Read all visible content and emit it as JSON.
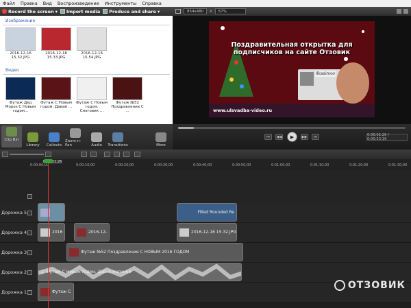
{
  "menu": [
    "Файл",
    "Правка",
    "Вид",
    "Воспроизведение",
    "Инструменты",
    "Справка"
  ],
  "toolbar": {
    "record": "Record the screen",
    "import": "Import media",
    "produce": "Produce and share"
  },
  "preview_toolbar": {
    "size": "854x480",
    "zoom": "67%"
  },
  "clipbin": {
    "images_header": "Изображение",
    "images": [
      {
        "name": "2016-12-16 15.32.JPG",
        "color": "#c9d3e0"
      },
      {
        "name": "2016-12-16 15.33.JPG",
        "color": "#b8282e"
      },
      {
        "name": "2016-12-16 15.54.JPG",
        "color": "#e0e0e0"
      }
    ],
    "video_header": "Видео",
    "videos": [
      {
        "name": "Футаж Дед Мороз С Новым годом…",
        "color": "#0b2a55"
      },
      {
        "name": "Футаж С Новым годом. Давай …",
        "color": "#5a1418"
      },
      {
        "name": "Футаж С Новым годом. Снеговик …",
        "color": "#f0f0f0"
      },
      {
        "name": "Футаж №52 Поздравление С …",
        "color": "#4a1212"
      }
    ]
  },
  "tabs": [
    {
      "label": "Clip Bin",
      "icon": "clip-bin-icon",
      "active": true
    },
    {
      "label": "Library",
      "icon": "library-icon"
    },
    {
      "label": "Callouts",
      "icon": "callouts-icon"
    },
    {
      "label": "Zoom-n-Pan",
      "icon": "zoom-icon"
    },
    {
      "label": "Audio",
      "icon": "audio-icon"
    },
    {
      "label": "Transitions",
      "icon": "transitions-icon"
    },
    {
      "label": "More",
      "icon": "more-icon"
    }
  ],
  "video": {
    "title": "Поздравительная открытка для подписчиков на сайте Отзовик",
    "url": "www.ulsvadba-video.ru",
    "name": "Ilkasimov"
  },
  "transport": {
    "time": "0:00:02;26 / 0:00:53;19",
    "progress": 0.07
  },
  "ruler": [
    "0:00:00;00",
    "0:00:02;26",
    "0:00:10;00",
    "0:00:20;00",
    "0:00:30;00",
    "0:00:40;00",
    "0:00:50;00",
    "0:01:00;00",
    "0:01:10;00",
    "0:01:20;00",
    "0:01:30;00"
  ],
  "tracks": [
    {
      "label": "Дорожка 5",
      "clips": [
        {
          "text": ""
        },
        {
          "text": "Filled Rounded Re"
        }
      ]
    },
    {
      "label": "Дорожка 4",
      "clips": [
        {
          "text": "2016"
        },
        {
          "text": "2016-12-"
        },
        {
          "text": "2016-12-16 15.32.JPG"
        }
      ]
    },
    {
      "label": "Дорожка 3",
      "clips": [
        {
          "text": "Футаж №52 Поздравление С НОВЫМ 2016 ГОДОМ"
        }
      ]
    },
    {
      "label": "Дорожка 2",
      "clips": [
        {
          "text": "Футаж С Новым годом. Давай малиной"
        }
      ]
    },
    {
      "label": "Дорожка 1",
      "clips": [
        {
          "text": "Футаж С"
        }
      ]
    }
  ],
  "watermark": "ОТЗОВИК"
}
